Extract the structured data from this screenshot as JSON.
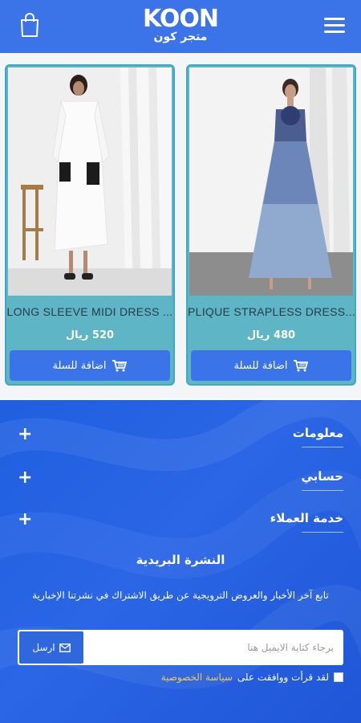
{
  "header": {
    "logo_main": "KOON",
    "logo_sub": "متجر كون",
    "bag_icon": "shopping-bag-icon",
    "menu_icon": "hamburger-menu-icon"
  },
  "products": [
    {
      "name": "PLIQUE STRAPLESS DRESS...",
      "price": "480 ريال",
      "add_to_cart": "اضافة للسلة"
    },
    {
      "name": "LONG SLEEVE MIDI DRESS ...",
      "price": "520 ريال",
      "add_to_cart": "اضافة للسلة"
    }
  ],
  "footer": {
    "sections": [
      {
        "title": "معلومات"
      },
      {
        "title": "حسابي"
      },
      {
        "title": "خدمة العملاء"
      }
    ],
    "newsletter": {
      "title": "النشرة البريدية",
      "description": "تابع آخر الأخبار والعروض الترويجية عن طريق الاشتراك في نشرتنا الإخبارية",
      "placeholder": "برجاء كتابة الايميل هنا",
      "send_label": "ارسل",
      "agree_text": "لقد قرأت ووافقت على",
      "policy_link": "سياسة الخصوصية"
    }
  },
  "colors": {
    "brand_blue": "#3b74e8",
    "card_teal": "#5db5c6",
    "footer_blue": "#1f5fe0",
    "link_yellow": "#f2c94c"
  }
}
